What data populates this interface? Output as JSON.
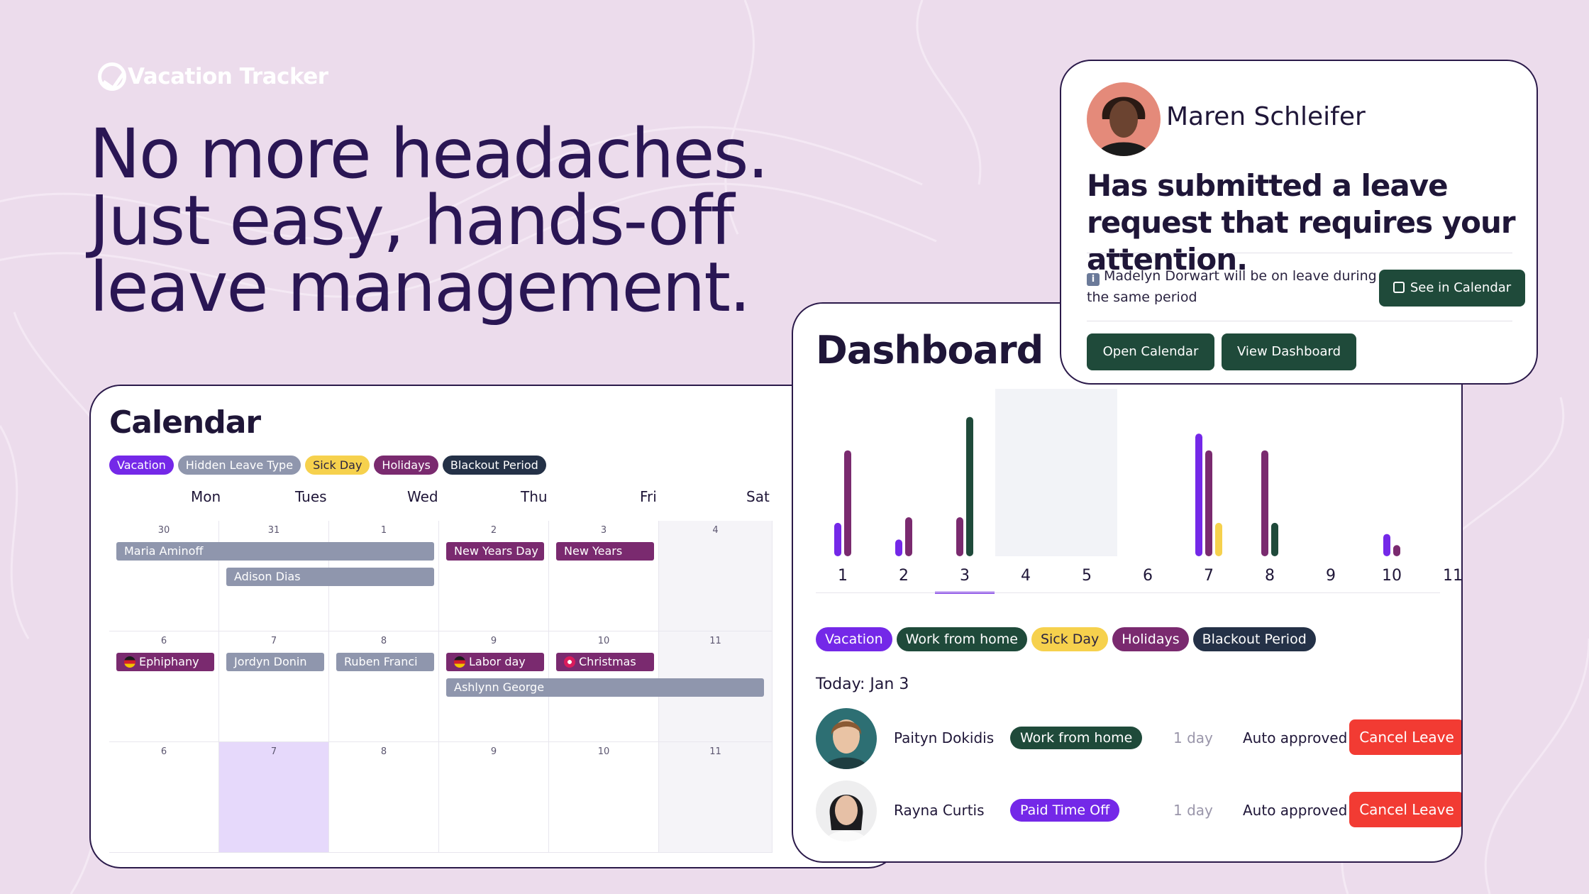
{
  "brand": {
    "name": "Vacation Tracker"
  },
  "headline": [
    "No more headaches.",
    "Just easy, hands-off",
    "leave management."
  ],
  "colors": {
    "vacation": "#7428e8",
    "hidden": "#8f96ad",
    "sick": "#f6d14d",
    "holiday": "#7a2a6f",
    "blackout": "#243147",
    "wfh": "#1f4a3a",
    "danger": "#f23b33"
  },
  "calendar": {
    "title": "Calendar",
    "legend": [
      "Vacation",
      "Hidden Leave Type",
      "Sick Day",
      "Holidays",
      "Blackout Period"
    ],
    "weekdays": [
      "Mon",
      "Tues",
      "Wed",
      "Thu",
      "Fri",
      "Sat"
    ],
    "weeks": [
      [
        "30",
        "31",
        "1",
        "2",
        "3",
        "4"
      ],
      [
        "6",
        "7",
        "8",
        "9",
        "10",
        "11"
      ],
      [
        "6",
        "7",
        "8",
        "9",
        "10",
        "11"
      ]
    ],
    "events": {
      "maria": "Maria Aminoff",
      "adison": "Adison Dias",
      "newyearsday": "New Years Day",
      "newyears": "New Years",
      "ephiphany": "Ephiphany",
      "jordyn": "Jordyn Donin",
      "ruben": "Ruben Franci",
      "labor": "Labor day",
      "christmas": "Christmas",
      "ashlynn": "Ashlynn George"
    }
  },
  "dashboard": {
    "title": "Dashboard",
    "legend": [
      "Vacation",
      "Work from home",
      "Sick Day",
      "Holidays",
      "Blackout Period"
    ],
    "today_label": "Today: Jan 3",
    "rows": [
      {
        "name": "Paityn Dokidis",
        "type": "Work from home",
        "days": "1 day",
        "status": "Auto approved",
        "action": "Cancel Leave"
      },
      {
        "name": "Rayna Curtis",
        "type": "Paid Time Off",
        "days": "1 day",
        "status": "Auto approved",
        "action": "Cancel Leave"
      }
    ]
  },
  "chart_data": {
    "type": "bar",
    "categories": [
      "1",
      "2",
      "3",
      "4",
      "5",
      "6",
      "7",
      "8",
      "9",
      "10",
      "11"
    ],
    "series": [
      {
        "color": "#7428e8",
        "values": [
          3,
          1.5,
          0,
          0,
          0,
          0,
          11,
          0,
          0,
          2,
          0
        ]
      },
      {
        "color": "#7a2a6f",
        "values": [
          9.5,
          3.5,
          3.5,
          0,
          0,
          0,
          9.5,
          9.5,
          0,
          1,
          0
        ]
      },
      {
        "color": "#1f4a3a",
        "values": [
          0,
          0,
          12.5,
          0,
          0,
          0,
          0,
          3,
          0,
          0,
          0
        ]
      },
      {
        "color": "#f6d14d",
        "values": [
          0,
          0,
          0,
          0,
          0,
          0,
          3,
          0,
          0,
          0,
          0
        ]
      }
    ],
    "blackout_range": [
      "4",
      "5"
    ],
    "selected": "3",
    "ylim": [
      0,
      14
    ]
  },
  "notification": {
    "name": "Maren Schleifer",
    "message": "Has submitted a leave request that requires your attention.",
    "note": "Madelyn Dorwart will be on leave during the same period",
    "see_calendar": "See in Calendar",
    "open_calendar": "Open Calendar",
    "view_dashboard": "View Dashboard"
  }
}
